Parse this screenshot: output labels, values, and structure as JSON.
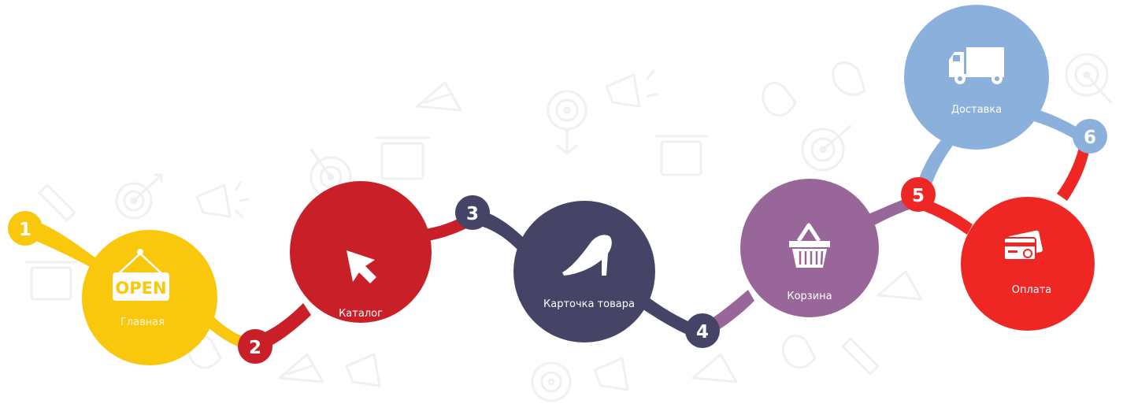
{
  "steps": [
    {
      "number": "1",
      "label": "Главная",
      "icon": "open-sign-icon",
      "icon_text": "OPEN",
      "color": "#f9c80d"
    },
    {
      "number": "2",
      "label": "Каталог",
      "icon": "cursor-arrow-icon",
      "color": "#c81f28"
    },
    {
      "number": "3",
      "label": "Карточка товара",
      "icon": "high-heel-shoe-icon",
      "color": "#454466"
    },
    {
      "number": "4",
      "label": "Корзина",
      "icon": "shopping-basket-icon",
      "color": "#996699"
    },
    {
      "number": "5",
      "label": "Доставка",
      "icon": "delivery-truck-icon",
      "color": "#8cb0dc"
    },
    {
      "number": "6",
      "label": "Оплата",
      "icon": "credit-card-icon",
      "color": "#ee2624"
    }
  ],
  "colors": {
    "background": "#ffffff",
    "pattern": "#f0f0f0",
    "text": "#ffffff"
  }
}
